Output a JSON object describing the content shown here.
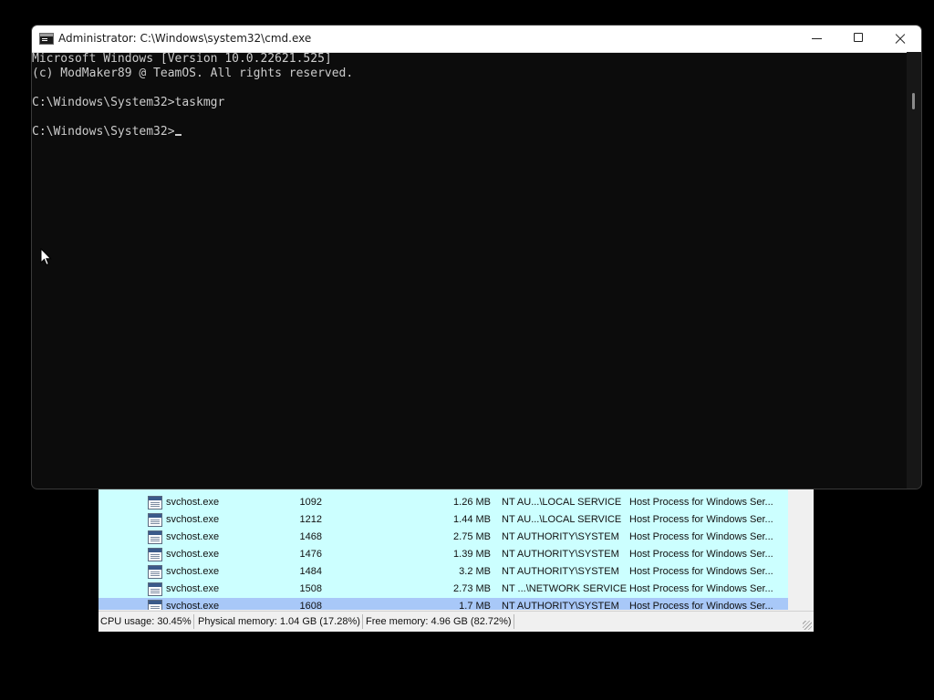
{
  "cmd_window": {
    "title": "Administrator: C:\\Windows\\system32\\cmd.exe",
    "console_lines": [
      "Microsoft Windows [Version 10.0.22621.525]",
      "(c) ModMaker89 @ TeamOS. All rights reserved.",
      "",
      "C:\\Windows\\System32>taskmgr",
      "",
      "C:\\Windows\\System32>"
    ]
  },
  "task_manager": {
    "process_rows": [
      {
        "name": "svchost.exe",
        "pid": "1092",
        "memory": "1.26 MB",
        "user": "NT AU...\\LOCAL SERVICE",
        "description": "Host Process for Windows Ser..."
      },
      {
        "name": "svchost.exe",
        "pid": "1212",
        "memory": "1.44 MB",
        "user": "NT AU...\\LOCAL SERVICE",
        "description": "Host Process for Windows Ser..."
      },
      {
        "name": "svchost.exe",
        "pid": "1468",
        "memory": "2.75 MB",
        "user": "NT AUTHORITY\\SYSTEM",
        "description": "Host Process for Windows Ser..."
      },
      {
        "name": "svchost.exe",
        "pid": "1476",
        "memory": "1.39 MB",
        "user": "NT AUTHORITY\\SYSTEM",
        "description": "Host Process for Windows Ser..."
      },
      {
        "name": "svchost.exe",
        "pid": "1484",
        "memory": "3.2 MB",
        "user": "NT AUTHORITY\\SYSTEM",
        "description": "Host Process for Windows Ser..."
      },
      {
        "name": "svchost.exe",
        "pid": "1508",
        "memory": "2.73 MB",
        "user": "NT ...\\NETWORK SERVICE",
        "description": "Host Process for Windows Ser..."
      },
      {
        "name": "svchost.exe",
        "pid": "1608",
        "memory": "1.7 MB",
        "user": "NT AUTHORITY\\SYSTEM",
        "description": "Host Process for Windows Ser..."
      }
    ],
    "status_bar": {
      "cpu_usage": "CPU usage: 30.45%",
      "physical_memory": "Physical memory: 1.04 GB (17.28%)",
      "free_memory": "Free memory: 4.96 GB (82.72%)"
    }
  },
  "colors": {
    "desktop_background": "#000000",
    "console_background": "#0c0c0c",
    "console_text": "#cccccc",
    "process_list_background": "#ccffff",
    "selected_row": "#a8c8f8"
  }
}
